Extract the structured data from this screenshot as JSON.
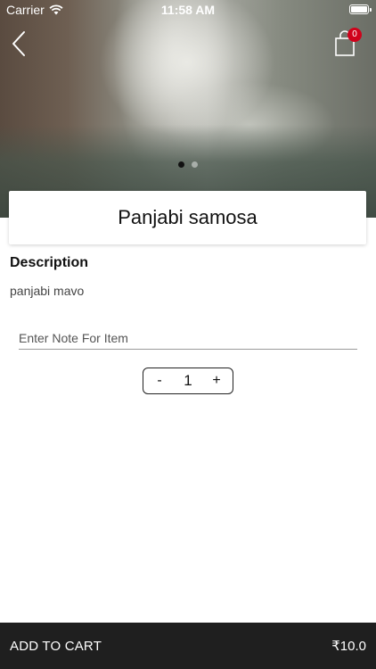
{
  "status_bar": {
    "carrier": "Carrier",
    "time": "11:58 AM"
  },
  "nav": {
    "back_icon": "chevron-left-icon",
    "cart_icon": "shopping-bag-icon",
    "cart_count": "0"
  },
  "carousel": {
    "page_count": 2,
    "active_index": 0
  },
  "item": {
    "title": "Panjabi samosa",
    "description_heading": "Description",
    "description": "panjabi mavo"
  },
  "note": {
    "placeholder": "Enter Note For Item",
    "value": ""
  },
  "quantity": {
    "minus_label": "-",
    "value": "1",
    "plus_label": "+"
  },
  "footer": {
    "add_to_cart_label": "ADD TO CART",
    "price": "₹10.0"
  },
  "colors": {
    "badge": "#d0021b",
    "footer_bg": "#1f1f1f"
  }
}
